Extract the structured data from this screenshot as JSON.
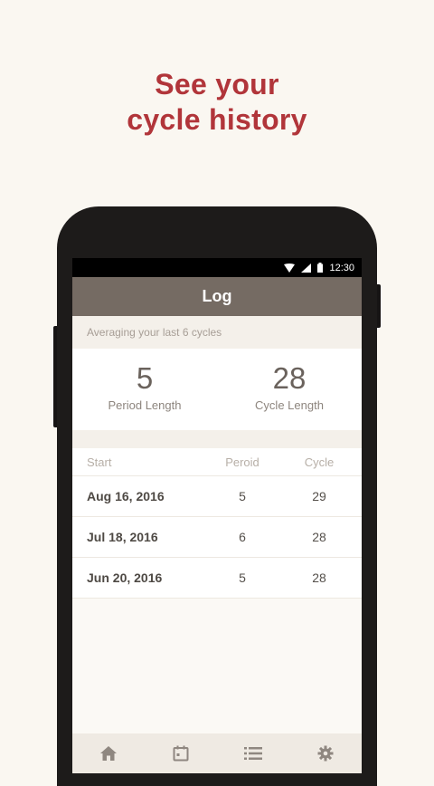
{
  "promo": {
    "headline_line1": "See your",
    "headline_line2": "cycle history",
    "headline_color": "#b1353a"
  },
  "status_bar": {
    "time": "12:30",
    "icons": [
      "wifi-icon",
      "signal-icon",
      "battery-icon"
    ]
  },
  "app_bar": {
    "title": "Log"
  },
  "summary": {
    "caption": "Averaging your last 6 cycles",
    "period_value": "5",
    "period_label": "Period Length",
    "cycle_value": "28",
    "cycle_label": "Cycle Length"
  },
  "history": {
    "headers": {
      "start": "Start",
      "period": "Peroid",
      "cycle": "Cycle"
    },
    "rows": [
      {
        "start": "Aug 16, 2016",
        "period": "5",
        "cycle": "29"
      },
      {
        "start": "Jul 18, 2016",
        "period": "6",
        "cycle": "28"
      },
      {
        "start": "Jun 20, 2016",
        "period": "5",
        "cycle": "28"
      }
    ]
  },
  "bottom_nav": {
    "items": [
      "home-icon",
      "calendar-icon",
      "list-icon",
      "settings-icon"
    ]
  },
  "colors": {
    "app_bar": "#756b63",
    "background": "#faf7f1",
    "accent": "#b1353a"
  }
}
